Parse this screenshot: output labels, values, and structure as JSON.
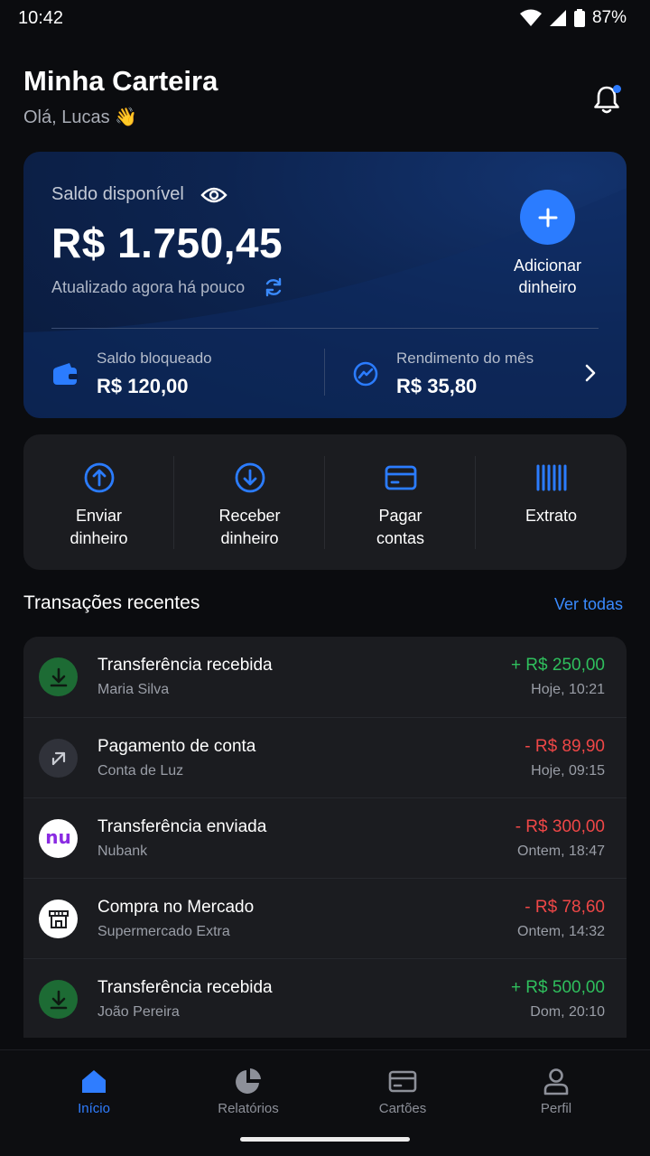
{
  "status_bar": {
    "time": "10:42",
    "battery": "87%"
  },
  "header": {
    "title": "Minha Carteira",
    "greeting": "Olá, Lucas 👋"
  },
  "balance": {
    "label": "Saldo disponível",
    "amount": "R$ 1.750,45",
    "updated": "Atualizado agora há pouco",
    "add_label_line1": "Adicionar",
    "add_label_line2": "dinheiro",
    "blocked_label": "Saldo bloqueado",
    "blocked_value": "R$ 120,00",
    "yield_label": "Rendimento do mês",
    "yield_value": "R$ 35,80"
  },
  "actions": [
    {
      "line1": "Enviar",
      "line2": "dinheiro",
      "icon": "upload-icon"
    },
    {
      "line1": "Receber",
      "line2": "dinheiro",
      "icon": "download-icon"
    },
    {
      "line1": "Pagar",
      "line2": "contas",
      "icon": "card-icon"
    },
    {
      "line1": "Extrato",
      "line2": "",
      "icon": "barcode-icon"
    }
  ],
  "transactions": {
    "heading": "Transações recentes",
    "see_all": "Ver todas",
    "items": [
      {
        "title": "Transferência recebida",
        "subtitle": "Maria Silva",
        "amount": "+ R$ 250,00",
        "date": "Hoje, 10:21",
        "type": "in",
        "icon": "download-icon"
      },
      {
        "title": "Pagamento de conta",
        "subtitle": "Conta de Luz",
        "amount": "- R$ 89,90",
        "date": "Hoje, 09:15",
        "type": "out",
        "icon": "arrow-up-right-icon"
      },
      {
        "title": "Transferência enviada",
        "subtitle": "Nubank",
        "amount": "- R$ 300,00",
        "date": "Ontem, 18:47",
        "type": "out",
        "icon": "nubank-logo",
        "logo_text": "nu"
      },
      {
        "title": "Compra no Mercado",
        "subtitle": "Supermercado Extra",
        "amount": "- R$ 78,60",
        "date": "Ontem, 14:32",
        "type": "out",
        "icon": "store-icon"
      },
      {
        "title": "Transferência recebida",
        "subtitle": "João Pereira",
        "amount": "+ R$ 500,00",
        "date": "Dom, 20:10",
        "type": "in",
        "icon": "download-icon"
      }
    ]
  },
  "bottom_nav": [
    {
      "label": "Início",
      "icon": "home-icon",
      "active": true
    },
    {
      "label": "Relatórios",
      "icon": "pie-chart-icon",
      "active": false
    },
    {
      "label": "Cartões",
      "icon": "card-icon",
      "active": false
    },
    {
      "label": "Perfil",
      "icon": "user-icon",
      "active": false
    }
  ],
  "colors": {
    "accent": "#2b7cff",
    "positive": "#2fbf5d",
    "negative": "#ef4747",
    "background": "#0b0c0f",
    "surface": "#1b1c20"
  }
}
